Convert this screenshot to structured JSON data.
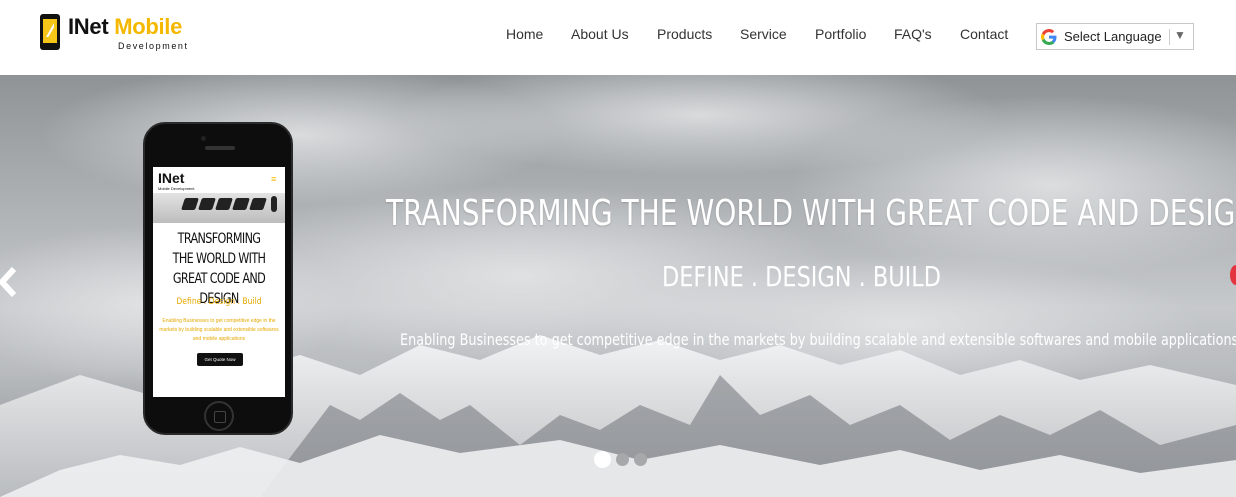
{
  "brand": {
    "name_part1": "INet",
    "name_part2": "Mobile",
    "subtitle": "Development"
  },
  "nav": {
    "items": [
      {
        "label": "Home"
      },
      {
        "label": "About Us"
      },
      {
        "label": "Products"
      },
      {
        "label": "Service"
      },
      {
        "label": "Portfolio"
      },
      {
        "label": "FAQ's"
      },
      {
        "label": "Contact"
      }
    ]
  },
  "translate": {
    "label": "Select Language",
    "icon": "google-g-icon",
    "arrow": "▼"
  },
  "hero": {
    "title": "TRANSFORMING THE WORLD WITH GREAT CODE AND DESIGN",
    "subtitle": "DEFINE . DESIGN . BUILD",
    "description": "Enabling Businesses to get competitive edge in the markets by building scalable and extensible softwares and mobile applications",
    "slides_total": 3,
    "active_slide": 1
  },
  "phone_preview": {
    "logo": "INet",
    "logo_sub": "Mobile Development",
    "title": "TRANSFORMING THE WORLD WITH GREAT CODE AND DESIGN",
    "tagline": "Define . Design . Build",
    "description": "Enabling Businesses to get competitive edge in the markets by building scalable and extensible softwares and mobile applications",
    "button": "Get Quote Now"
  },
  "colors": {
    "accent": "#f5b800",
    "text_dark": "#333333",
    "header_bg": "#ffffff",
    "right_arrow": "#e2333f"
  }
}
